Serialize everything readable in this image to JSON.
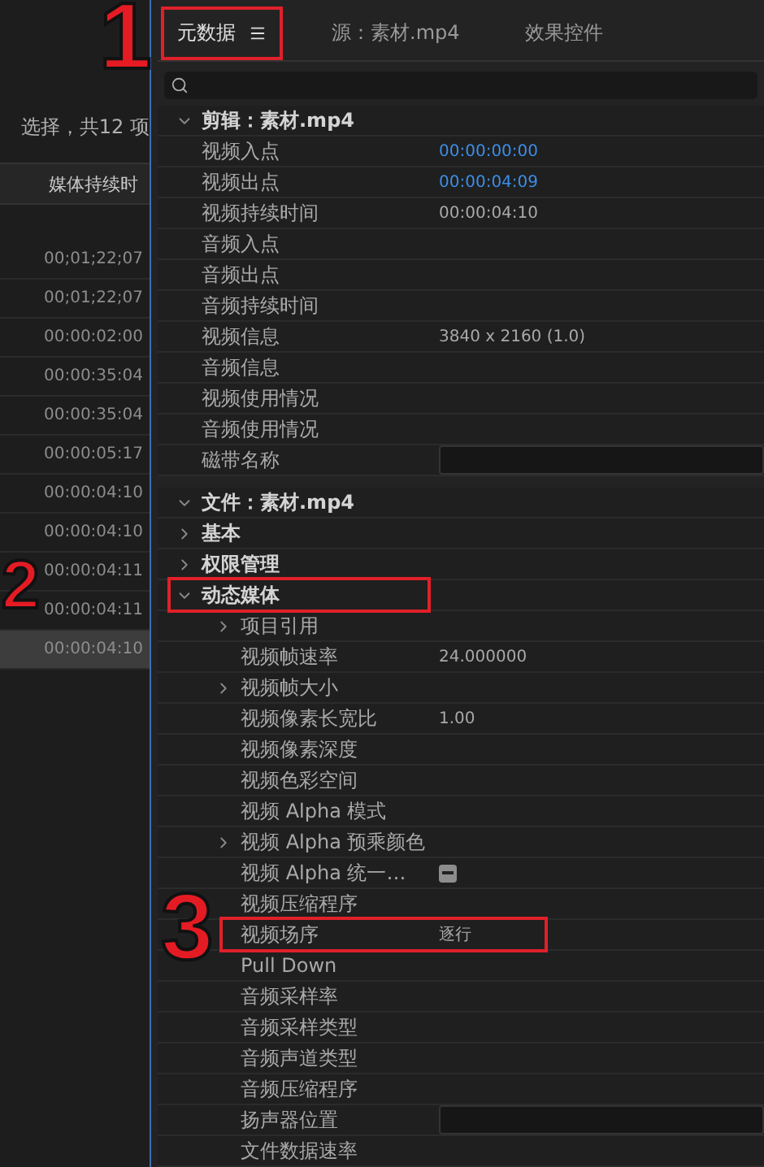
{
  "left_panel": {
    "summary": "选择，共12 项",
    "column_header": "媒体持续时",
    "rows": [
      {
        "duration": "00;01;22;07",
        "selected": false
      },
      {
        "duration": "00;01;22;07",
        "selected": false
      },
      {
        "duration": "00:00:02:00",
        "selected": false
      },
      {
        "duration": "00:00:35:04",
        "selected": false
      },
      {
        "duration": "00:00:35:04",
        "selected": false
      },
      {
        "duration": "00:00:05:17",
        "selected": false
      },
      {
        "duration": "00:00:04:10",
        "selected": false
      },
      {
        "duration": "00:00:04:10",
        "selected": false
      },
      {
        "duration": "00:00:04:11",
        "selected": false
      },
      {
        "duration": "00:00:04:11",
        "selected": false
      },
      {
        "duration": "00:00:04:10",
        "selected": true
      }
    ]
  },
  "tabs": [
    {
      "label": "元数据",
      "selected": true,
      "menu": true,
      "annotation": "1"
    },
    {
      "label": "源：素材.mp4",
      "selected": false
    },
    {
      "label": "效果控件",
      "selected": false
    }
  ],
  "metadata": [
    {
      "kind": "section",
      "label": "**剪辑**：素材.mp4",
      "expanded": true,
      "children": [
        {
          "kind": "field",
          "label": "视频入点",
          "value": "00:00:00:00",
          "link": true
        },
        {
          "kind": "field",
          "label": "视频出点",
          "value": "00:00:04:09",
          "link": true
        },
        {
          "kind": "field",
          "label": "视频持续时间",
          "value": "00:00:04:10",
          "link": false
        },
        {
          "kind": "field",
          "label": "音频入点"
        },
        {
          "kind": "field",
          "label": "音频出点"
        },
        {
          "kind": "field",
          "label": "音频持续时间"
        },
        {
          "kind": "field",
          "label": "视频信息",
          "value": "3840 x 2160 (1.0)",
          "link": false
        },
        {
          "kind": "field",
          "label": "音频信息"
        },
        {
          "kind": "field",
          "label": "视频使用情况"
        },
        {
          "kind": "field",
          "label": "音频使用情况"
        },
        {
          "kind": "input",
          "label": "磁带名称"
        }
      ]
    },
    {
      "kind": "section",
      "label": "**文件**：素材.mp4",
      "expanded": true,
      "children": [
        {
          "kind": "group",
          "label": "基本",
          "expanded": false
        },
        {
          "kind": "group",
          "label": "权限管理",
          "expanded": false
        },
        {
          "kind": "group",
          "label": "动态媒体",
          "expanded": true,
          "annotation": "2",
          "children": [
            {
              "kind": "field",
              "label": "项目引用",
              "expanded": false
            },
            {
              "kind": "field",
              "label": "视频帧速率",
              "value": "24.000000",
              "link": false
            },
            {
              "kind": "field",
              "label": "视频帧大小",
              "expanded": false
            },
            {
              "kind": "field",
              "label": "视频像素长宽比",
              "value": "1.00",
              "link": false
            },
            {
              "kind": "field",
              "label": "视频像素深度"
            },
            {
              "kind": "field",
              "label": "视频色彩空间"
            },
            {
              "kind": "field",
              "label": "视频 Alpha 模式"
            },
            {
              "kind": "field",
              "label": "视频 Alpha 预乘颜色",
              "expanded": false
            },
            {
              "kind": "checkbox",
              "label": "视频 Alpha 统一…",
              "mixed": true
            },
            {
              "kind": "field",
              "label": "视频压缩程序"
            },
            {
              "kind": "field",
              "label": "视频场序",
              "value": "逐行",
              "link": false,
              "annotation": "3"
            },
            {
              "kind": "field",
              "label": "Pull Down"
            },
            {
              "kind": "field",
              "label": "音频采样率"
            },
            {
              "kind": "field",
              "label": "音频采样类型"
            },
            {
              "kind": "field",
              "label": "音频声道类型"
            },
            {
              "kind": "field",
              "label": "音频压缩程序"
            },
            {
              "kind": "input",
              "label": "扬声器位置"
            },
            {
              "kind": "field",
              "label": "文件数据速率"
            }
          ]
        }
      ]
    }
  ]
}
